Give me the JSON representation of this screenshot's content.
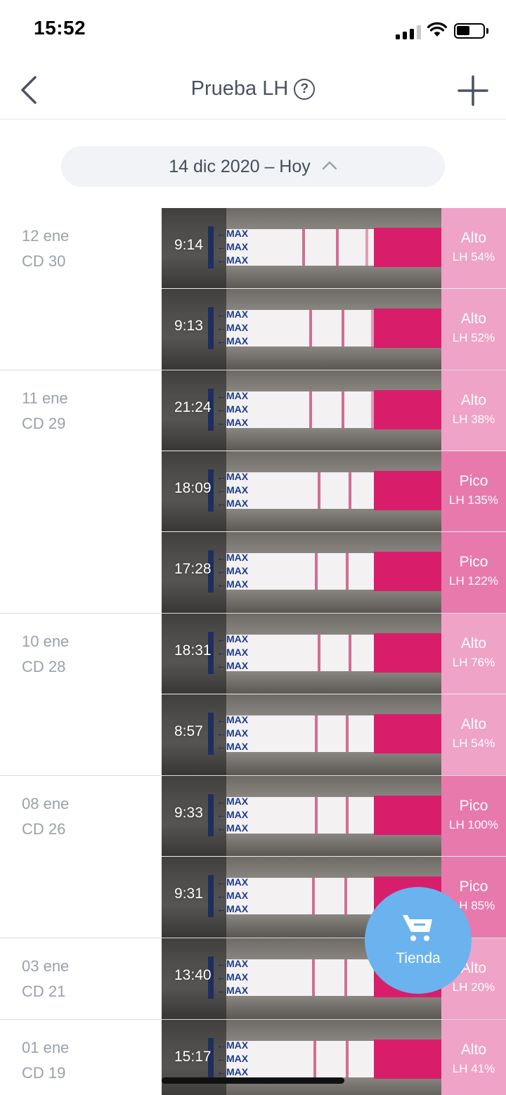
{
  "status_bar": {
    "time": "15:52"
  },
  "nav": {
    "title": "Prueba LH",
    "help_icon": "?"
  },
  "date_selector": {
    "label": "14 dic 2020 – Hoy"
  },
  "days": [
    {
      "date": "12 ene",
      "cycle_day": "CD 30",
      "entries": [
        {
          "time": "9:14",
          "result": "Alto",
          "lh": "LH 54%",
          "level": "alto"
        },
        {
          "time": "9:13",
          "result": "Alto",
          "lh": "LH 52%",
          "level": "alto"
        }
      ]
    },
    {
      "date": "11 ene",
      "cycle_day": "CD 29",
      "entries": [
        {
          "time": "21:24",
          "result": "Alto",
          "lh": "LH 38%",
          "level": "alto"
        },
        {
          "time": "18:09",
          "result": "Pico",
          "lh": "LH 135%",
          "level": "pico"
        },
        {
          "time": "17:28",
          "result": "Pico",
          "lh": "LH 122%",
          "level": "pico"
        }
      ]
    },
    {
      "date": "10 ene",
      "cycle_day": "CD 28",
      "entries": [
        {
          "time": "18:31",
          "result": "Alto",
          "lh": "LH 76%",
          "level": "alto"
        },
        {
          "time": "8:57",
          "result": "Alto",
          "lh": "LH 54%",
          "level": "alto"
        }
      ]
    },
    {
      "date": "08 ene",
      "cycle_day": "CD 26",
      "entries": [
        {
          "time": "9:33",
          "result": "Pico",
          "lh": "LH 100%",
          "level": "pico"
        },
        {
          "time": "9:31",
          "result": "Pico",
          "lh": "LH 85%",
          "level": "pico"
        }
      ]
    },
    {
      "date": "03 ene",
      "cycle_day": "CD 21",
      "entries": [
        {
          "time": "13:40",
          "result": "Alto",
          "lh": "LH 20%",
          "level": "alto"
        }
      ]
    },
    {
      "date": "01 ene",
      "cycle_day": "CD 19",
      "entries": [
        {
          "time": "15:17",
          "result": "Alto",
          "lh": "LH 41%",
          "level": "alto"
        }
      ]
    }
  ],
  "store_button": {
    "label": "Tienda"
  },
  "colors": {
    "alto": "#efa3c6",
    "pico": "#e879ad",
    "store": "#6ab3ef",
    "strip_pink": "#d81e6b"
  }
}
